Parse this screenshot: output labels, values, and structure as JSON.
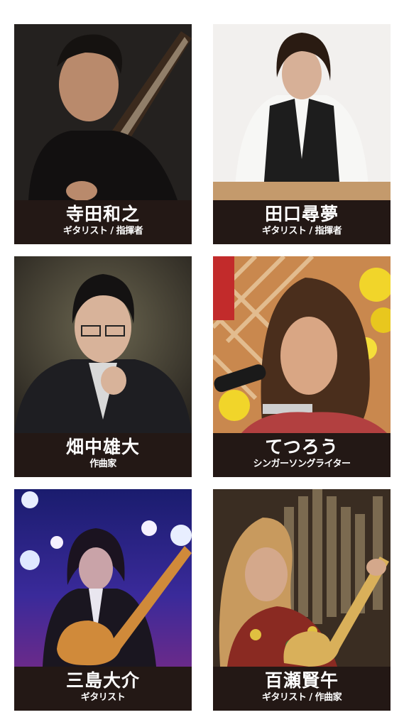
{
  "profiles": [
    {
      "name": "寺田和之",
      "role": "ギタリスト / 指揮者"
    },
    {
      "name": "田口尋夢",
      "role": "ギタリスト / 指揮者"
    },
    {
      "name": "畑中雄大",
      "role": "作曲家"
    },
    {
      "name": "てつろう",
      "role": "シンガーソングライター"
    },
    {
      "name": "三島大介",
      "role": "ギタリスト"
    },
    {
      "name": "百瀬賢午",
      "role": "ギタリスト / 作曲家"
    }
  ],
  "colors": {
    "caption_background": "#231815",
    "caption_text": "#ffffff",
    "page_background": "#ffffff"
  }
}
